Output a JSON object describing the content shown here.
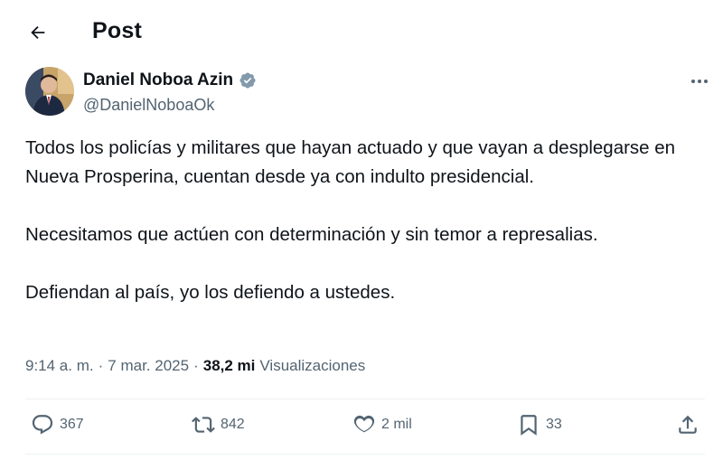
{
  "header": {
    "title": "Post"
  },
  "author": {
    "name": "Daniel Noboa Azin",
    "handle": "@DanielNoboaOk"
  },
  "post": {
    "paragraphs": [
      "Todos los policías y militares que hayan actuado y que vayan a desplegarse en Nueva Prosperina, cuentan desde ya con indulto presidencial.",
      "Necesitamos que actúen con determinación y sin temor a represalias.",
      "Defiendan al país, yo los defiendo a ustedes."
    ],
    "time": "9:14 a. m.",
    "separator": "·",
    "date": "7 mar. 2025",
    "views_count": "38,2 mi",
    "views_label": "Visualizaciones"
  },
  "actions": {
    "replies": "367",
    "reposts": "842",
    "likes": "2 mil",
    "bookmarks": "33"
  },
  "colors": {
    "verified": "#829aab",
    "muted": "#536471",
    "text": "#0f1419"
  }
}
